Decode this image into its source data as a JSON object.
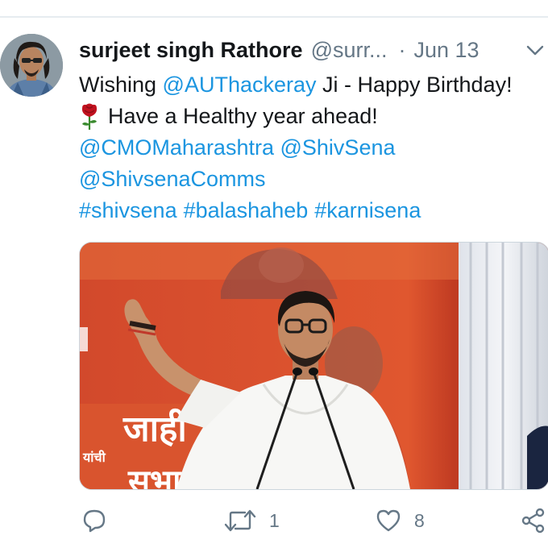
{
  "tweet": {
    "author_name": "surjeet singh Rathore",
    "author_handle": "@surr...",
    "separator": "·",
    "date": "Jun 13",
    "lines": {
      "l1_prefix": "Wishing ",
      "l1_mention": "@AUThackeray",
      "l1_suffix": " Ji - Happy Birthday!",
      "l2_text": "Have a Healthy year ahead!",
      "l3_mention1": "@CMOMaharashtra",
      "l3_space": " ",
      "l3_mention2": "@ShivSena",
      "l4_mention": "@ShivsenaComms",
      "l5_tag1": "#shivsena",
      "l5_tag2": "#balashaheb",
      "l5_tag3": "#karnisena"
    },
    "image_text": {
      "banner_big": "जाही",
      "banner_small": "यांची",
      "banner_bottom": "सभा"
    },
    "actions": {
      "reply_count": "",
      "retweet_count": "1",
      "like_count": "8"
    }
  },
  "colors": {
    "link": "#1b95e0",
    "text": "#14171a",
    "muted": "#657786"
  },
  "icons": [
    "chevron-down-icon",
    "rose-emoji-icon",
    "reply-icon",
    "retweet-icon",
    "like-icon",
    "share-icon"
  ]
}
